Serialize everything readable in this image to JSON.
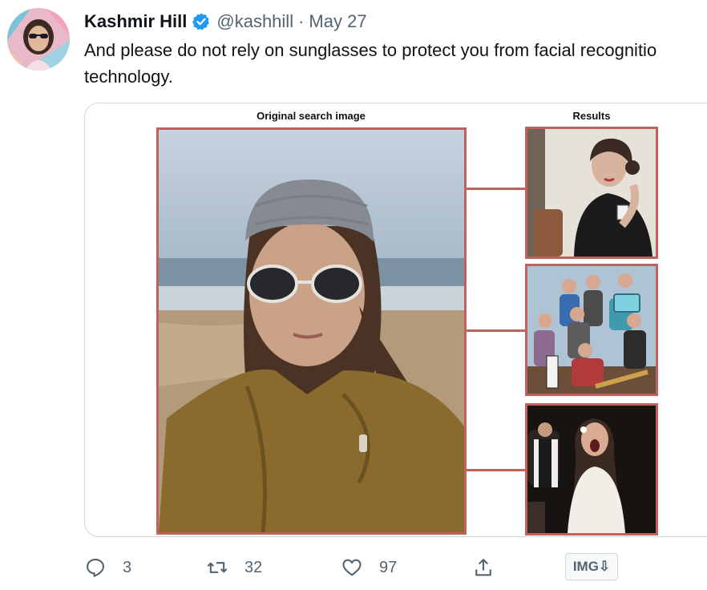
{
  "tweet": {
    "author_name": "Kashmir Hill",
    "handle": "@kashhill",
    "separator": "·",
    "date": "May 27",
    "text_line1": "And please do not rely on sunglasses to protect you from facial recognitio",
    "text_line2": "technology.",
    "verified_icon": "verified-badge-icon",
    "accent_color": "#1d9bf0"
  },
  "media": {
    "left_label": "Original search image",
    "right_label": "Results",
    "frame_color": "#c0625b",
    "results_count": 3
  },
  "actions": {
    "reply_count": "3",
    "retweet_count": "32",
    "like_count": "97",
    "image_button_label": "IMG⇩",
    "icons": [
      "reply-icon",
      "retweet-icon",
      "like-icon",
      "share-icon"
    ]
  }
}
